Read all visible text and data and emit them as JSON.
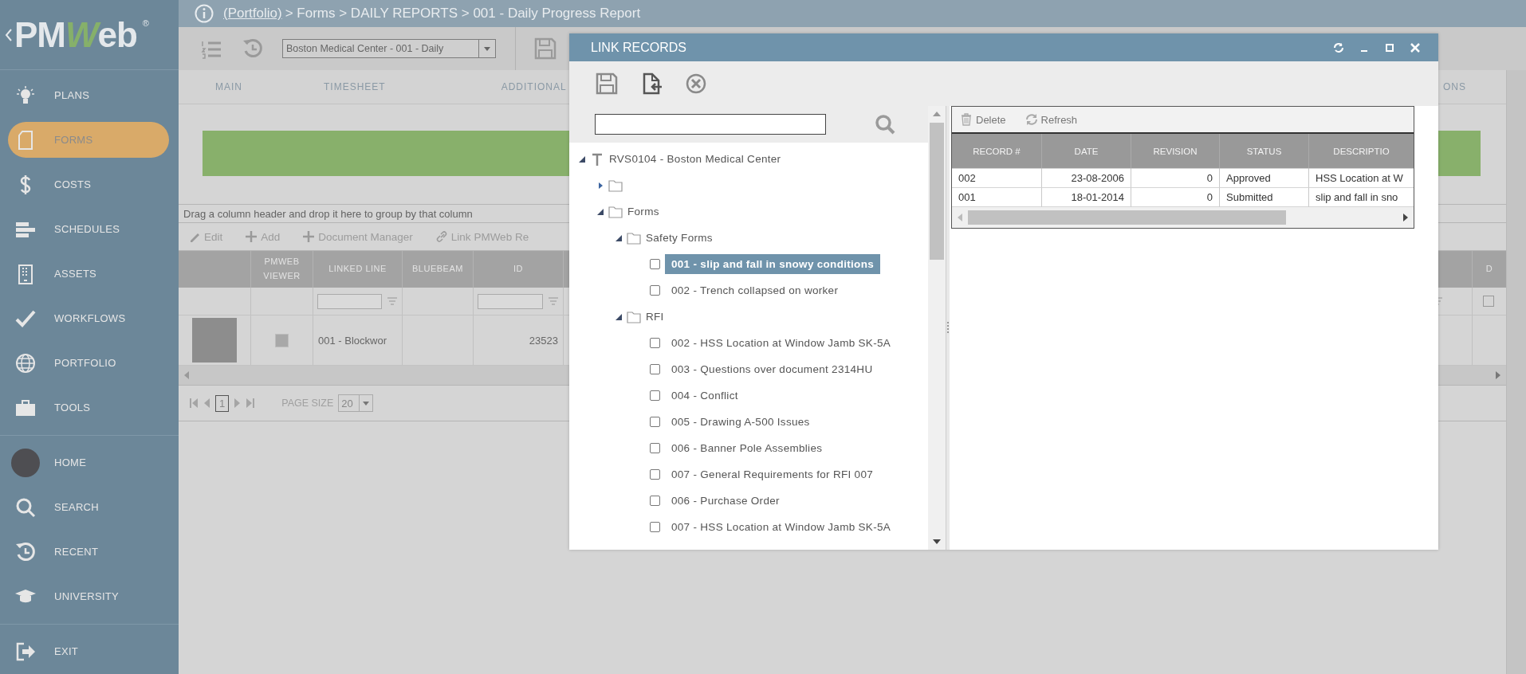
{
  "logo": {
    "parts": [
      "PM",
      "W",
      "eb"
    ],
    "mark": "®"
  },
  "sidebar": {
    "items": [
      {
        "label": "PLANS",
        "selected": false
      },
      {
        "label": "FORMS",
        "selected": true
      },
      {
        "label": "COSTS",
        "selected": false
      },
      {
        "label": "SCHEDULES",
        "selected": false
      },
      {
        "label": "ASSETS",
        "selected": false
      },
      {
        "label": "WORKFLOWS",
        "selected": false
      },
      {
        "label": "PORTFOLIO",
        "selected": false
      },
      {
        "label": "TOOLS",
        "selected": false
      },
      {
        "label": "HOME",
        "selected": false
      },
      {
        "label": "SEARCH",
        "selected": false
      },
      {
        "label": "RECENT",
        "selected": false
      },
      {
        "label": "UNIVERSITY",
        "selected": false
      },
      {
        "label": "EXIT",
        "selected": false
      }
    ]
  },
  "breadcrumb": {
    "link": "(Portfolio)",
    "rest": "> Forms > DAILY REPORTS > 001 - Daily Progress Report"
  },
  "toolbar": {
    "record_select": "Boston Medical Center - 001 - Daily"
  },
  "tabs": [
    "MAIN",
    "TIMESHEET",
    "ADDITIONAL",
    "ONS"
  ],
  "grid": {
    "group_hint": "Drag a column header and drop it here to group by that column",
    "actions": [
      "Edit",
      "Add",
      "Document Manager",
      "Link PMWeb Re"
    ],
    "columns": [
      "PMWEB VIEWER",
      "LINKED LINE",
      "BLUEBEAM",
      "ID"
    ],
    "right_column": "D",
    "select_all_checked": false,
    "rows": [
      {
        "viewer_checked": false,
        "linked_line": "001 - Blockwor",
        "id": "23523"
      }
    ],
    "pager": {
      "page": "1",
      "page_size_label": "PAGE SIZE",
      "page_size": "20"
    }
  },
  "dialog": {
    "title": "LINK RECORDS",
    "tree": [
      {
        "kind": "project",
        "label": "RVS0104 - Boston Medical Center",
        "expanded": true,
        "children": [
          {
            "kind": "folder",
            "expanded": false
          },
          {
            "kind": "folder",
            "label": "Forms",
            "expanded": true,
            "children": [
              {
                "kind": "folder",
                "label": "Safety Forms",
                "expanded": true,
                "children": [
                  {
                    "kind": "record",
                    "label": "001 - slip and fall in snowy conditions",
                    "checked": false,
                    "selected": true
                  },
                  {
                    "kind": "record",
                    "label": "002 - Trench collapsed on worker",
                    "checked": false,
                    "selected": false
                  }
                ]
              },
              {
                "kind": "folder",
                "label": "RFI",
                "expanded": true,
                "children": [
                  {
                    "kind": "record",
                    "label": "002 - HSS Location at Window Jamb SK-5A",
                    "checked": false,
                    "selected": false
                  },
                  {
                    "kind": "record",
                    "label": "003 - Questions over document 2314HU",
                    "checked": false,
                    "selected": false
                  },
                  {
                    "kind": "record",
                    "label": "004 - Conflict",
                    "checked": false,
                    "selected": false
                  },
                  {
                    "kind": "record",
                    "label": "005 - Drawing A-500 Issues",
                    "checked": false,
                    "selected": false
                  },
                  {
                    "kind": "record",
                    "label": "006 - Banner Pole Assemblies",
                    "checked": false,
                    "selected": false
                  },
                  {
                    "kind": "record",
                    "label": "007 - General Requirements for RFI 007",
                    "checked": false,
                    "selected": false
                  },
                  {
                    "kind": "record",
                    "label": "006 - Purchase Order",
                    "checked": false,
                    "selected": false
                  },
                  {
                    "kind": "record",
                    "label": "007 - HSS Location at Window Jamb SK-5A",
                    "checked": false,
                    "selected": false
                  }
                ]
              }
            ]
          }
        ]
      }
    ],
    "records": {
      "actions": [
        "Delete",
        "Refresh"
      ],
      "columns": [
        "RECORD #",
        "DATE",
        "REVISION",
        "STATUS",
        "DESCRIPTIO"
      ],
      "rows": [
        [
          "002",
          "23-08-2006",
          "0",
          "Approved",
          "HSS Location at W"
        ],
        [
          "001",
          "18-01-2014",
          "0",
          "Submitted",
          "slip and fall in sno"
        ]
      ]
    }
  }
}
